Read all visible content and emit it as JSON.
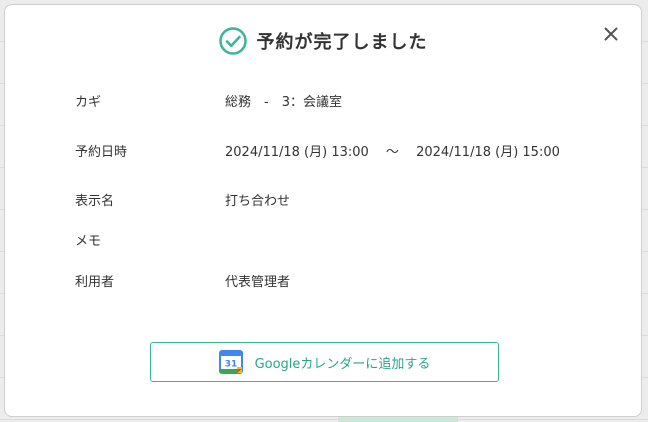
{
  "dialog": {
    "title": "予約が完了しました",
    "close_symbol": "✕"
  },
  "details": [
    {
      "label": "カギ",
      "value": "総務　-　3：会議室"
    },
    {
      "label": "予約日時",
      "value": "2024/11/18 (月) 13:00　 〜 　2024/11/18 (月) 15:00"
    },
    {
      "label": "表示名",
      "value": "打ち合わせ"
    },
    {
      "label": "メモ",
      "value": ""
    },
    {
      "label": "利用者",
      "value": "代表管理者"
    }
  ],
  "gcal_button": {
    "label": "Googleカレンダーに追加する",
    "icon_day": "31"
  },
  "colors": {
    "accent": "#3bb59a",
    "text": "#333333"
  },
  "icons": {
    "success": "check-circle-icon",
    "close": "close-icon",
    "calendar": "google-calendar-icon"
  }
}
